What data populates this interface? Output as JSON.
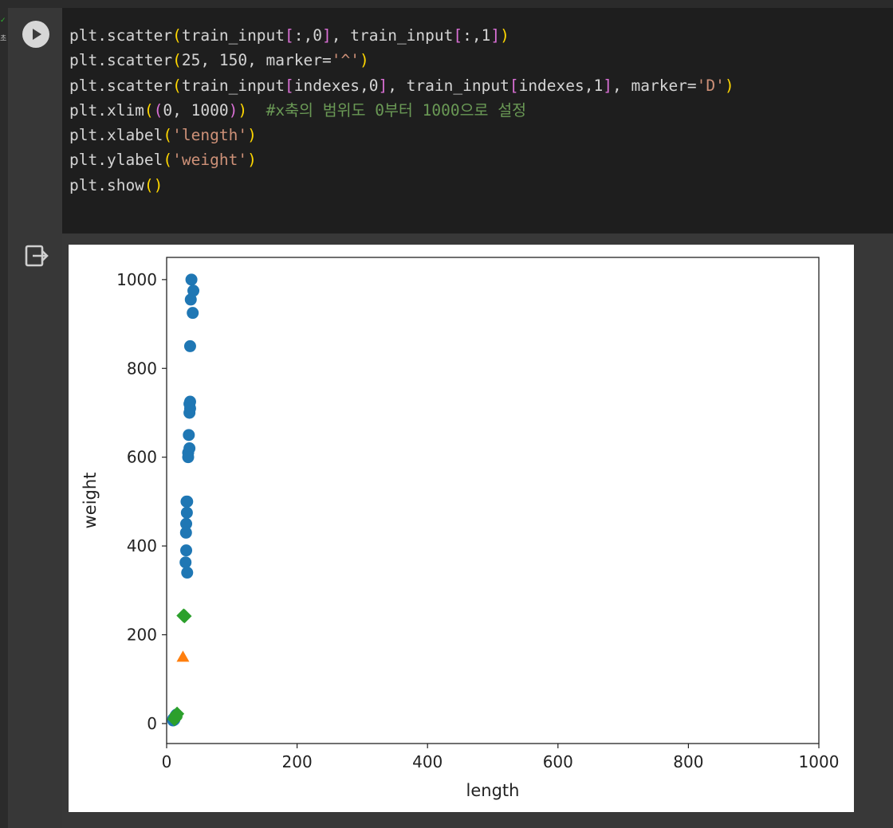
{
  "cell": {
    "code_lines": [
      [
        {
          "t": "plt.scatter",
          "c": ""
        },
        {
          "t": "(",
          "c": "br1"
        },
        {
          "t": "train_input",
          "c": ""
        },
        {
          "t": "[",
          "c": "br2"
        },
        {
          "t": ":,0",
          "c": ""
        },
        {
          "t": "]",
          "c": "br2"
        },
        {
          "t": ", train_input",
          "c": ""
        },
        {
          "t": "[",
          "c": "br2"
        },
        {
          "t": ":,1",
          "c": ""
        },
        {
          "t": "]",
          "c": "br2"
        },
        {
          "t": ")",
          "c": "br1"
        }
      ],
      [
        {
          "t": "plt.scatter",
          "c": ""
        },
        {
          "t": "(",
          "c": "br1"
        },
        {
          "t": "25, 150, marker=",
          "c": ""
        },
        {
          "t": "'^'",
          "c": "str"
        },
        {
          "t": ")",
          "c": "br1"
        }
      ],
      [
        {
          "t": "plt.scatter",
          "c": ""
        },
        {
          "t": "(",
          "c": "br1"
        },
        {
          "t": "train_input",
          "c": ""
        },
        {
          "t": "[",
          "c": "br2"
        },
        {
          "t": "indexes,0",
          "c": ""
        },
        {
          "t": "]",
          "c": "br2"
        },
        {
          "t": ", train_input",
          "c": ""
        },
        {
          "t": "[",
          "c": "br2"
        },
        {
          "t": "indexes,1",
          "c": ""
        },
        {
          "t": "]",
          "c": "br2"
        },
        {
          "t": ", marker=",
          "c": ""
        },
        {
          "t": "'D'",
          "c": "str"
        },
        {
          "t": ")",
          "c": "br1"
        }
      ],
      [
        {
          "t": "plt.xlim",
          "c": ""
        },
        {
          "t": "(",
          "c": "br1"
        },
        {
          "t": "(",
          "c": "br2"
        },
        {
          "t": "0, 1000",
          "c": ""
        },
        {
          "t": ")",
          "c": "br2"
        },
        {
          "t": ")",
          "c": "br1"
        },
        {
          "t": "  #x축의 범위도 0부터 1000으로 설정",
          "c": "cmt"
        }
      ],
      [
        {
          "t": "plt.xlabel",
          "c": ""
        },
        {
          "t": "(",
          "c": "br1"
        },
        {
          "t": "'length'",
          "c": "str"
        },
        {
          "t": ")",
          "c": "br1"
        }
      ],
      [
        {
          "t": "plt.ylabel",
          "c": ""
        },
        {
          "t": "(",
          "c": "br1"
        },
        {
          "t": "'weight'",
          "c": "str"
        },
        {
          "t": ")",
          "c": "br1"
        }
      ],
      [
        {
          "t": "plt.show",
          "c": ""
        },
        {
          "t": "()",
          "c": "br1"
        }
      ]
    ]
  },
  "gutter": {
    "run_icon": "play-icon",
    "output_icon": "output-exit-icon",
    "status_mark": "✓",
    "status_char": "초"
  },
  "colors": {
    "series_blue": "#1f77b4",
    "series_orange": "#ff7f0e",
    "series_green": "#2ca02c"
  },
  "chart_data": {
    "type": "scatter",
    "xlabel": "length",
    "ylabel": "weight",
    "xlim": [
      0,
      1000
    ],
    "ylim": [
      -45,
      1050
    ],
    "xticks": [
      "0",
      "200",
      "400",
      "600",
      "800",
      "1000"
    ],
    "yticks": [
      "0",
      "200",
      "400",
      "600",
      "800",
      "1000"
    ],
    "xtick_values": [
      0,
      200,
      400,
      600,
      800,
      1000
    ],
    "ytick_values": [
      0,
      200,
      400,
      600,
      800,
      1000
    ],
    "grid": false,
    "series": [
      {
        "marker": "circle",
        "color": "#1f77b4",
        "points": [
          [
            38,
            1000
          ],
          [
            41,
            975
          ],
          [
            37,
            955
          ],
          [
            40,
            925
          ],
          [
            36,
            850
          ],
          [
            36,
            725
          ],
          [
            35,
            720
          ],
          [
            35,
            700
          ],
          [
            36,
            710
          ],
          [
            34,
            650
          ],
          [
            35,
            620
          ],
          [
            33,
            610
          ],
          [
            33,
            600
          ],
          [
            30.5,
            500
          ],
          [
            31.5,
            500
          ],
          [
            31,
            475
          ],
          [
            30,
            450
          ],
          [
            29.7,
            430
          ],
          [
            30,
            390
          ],
          [
            29,
            363
          ],
          [
            31.5,
            340
          ],
          [
            12,
            12
          ],
          [
            11,
            8
          ],
          [
            10,
            10
          ],
          [
            14,
            18
          ],
          [
            13,
            15
          ],
          [
            15,
            20
          ],
          [
            9.8,
            7
          ],
          [
            11.8,
            9
          ]
        ]
      },
      {
        "marker": "triangle",
        "color": "#ff7f0e",
        "points": [
          [
            25,
            150
          ]
        ]
      },
      {
        "marker": "diamond",
        "color": "#2ca02c",
        "points": [
          [
            26,
            243
          ],
          [
            27.5,
            242
          ],
          [
            15,
            20
          ],
          [
            14,
            15
          ],
          [
            13,
            12
          ],
          [
            12,
            10
          ],
          [
            16,
            22
          ]
        ]
      }
    ]
  }
}
